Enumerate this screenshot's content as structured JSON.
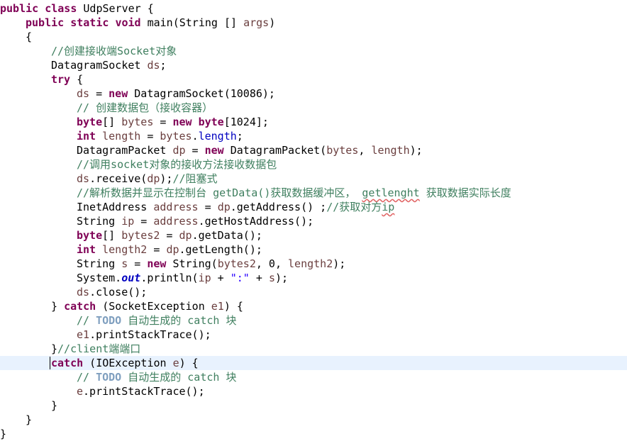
{
  "editor": {
    "lines": [
      {
        "indent": 0,
        "tokens": [
          {
            "t": "public",
            "c": "kw"
          },
          {
            "t": " "
          },
          {
            "t": "class",
            "c": "kw"
          },
          {
            "t": " UdpServer {"
          }
        ]
      },
      {
        "indent": 1,
        "tokens": [
          {
            "t": "public",
            "c": "kw"
          },
          {
            "t": " "
          },
          {
            "t": "static",
            "c": "kw"
          },
          {
            "t": " "
          },
          {
            "t": "void",
            "c": "kw"
          },
          {
            "t": " main(String [] "
          },
          {
            "t": "args",
            "c": "var"
          },
          {
            "t": ")"
          }
        ]
      },
      {
        "indent": 1,
        "tokens": [
          {
            "t": "{"
          }
        ]
      },
      {
        "indent": 2,
        "tokens": [
          {
            "t": "//创建接收端Socket对象",
            "c": "cm"
          }
        ]
      },
      {
        "indent": 2,
        "tokens": [
          {
            "t": "DatagramSocket "
          },
          {
            "t": "ds",
            "c": "var"
          },
          {
            "t": ";"
          }
        ]
      },
      {
        "indent": 2,
        "tokens": [
          {
            "t": "try",
            "c": "kw"
          },
          {
            "t": " {"
          }
        ]
      },
      {
        "indent": 3,
        "tokens": [
          {
            "t": "ds",
            "c": "var"
          },
          {
            "t": " = "
          },
          {
            "t": "new",
            "c": "kw"
          },
          {
            "t": " DatagramSocket(10086);"
          }
        ]
      },
      {
        "indent": 3,
        "tokens": [
          {
            "t": "// 创建数据包（接收容器）",
            "c": "cm"
          }
        ]
      },
      {
        "indent": 3,
        "tokens": [
          {
            "t": "byte",
            "c": "kw"
          },
          {
            "t": "[] "
          },
          {
            "t": "bytes",
            "c": "var"
          },
          {
            "t": " = "
          },
          {
            "t": "new",
            "c": "kw"
          },
          {
            "t": " "
          },
          {
            "t": "byte",
            "c": "kw"
          },
          {
            "t": "[1024];"
          }
        ]
      },
      {
        "indent": 3,
        "tokens": [
          {
            "t": "int",
            "c": "kw"
          },
          {
            "t": " "
          },
          {
            "t": "length",
            "c": "var"
          },
          {
            "t": " = "
          },
          {
            "t": "bytes",
            "c": "var"
          },
          {
            "t": "."
          },
          {
            "t": "length",
            "c": "fld"
          },
          {
            "t": ";"
          }
        ]
      },
      {
        "indent": 3,
        "tokens": [
          {
            "t": "DatagramPacket "
          },
          {
            "t": "dp",
            "c": "var"
          },
          {
            "t": " = "
          },
          {
            "t": "new",
            "c": "kw"
          },
          {
            "t": " DatagramPacket("
          },
          {
            "t": "bytes",
            "c": "var"
          },
          {
            "t": ", "
          },
          {
            "t": "length",
            "c": "var"
          },
          {
            "t": ");"
          }
        ]
      },
      {
        "indent": 3,
        "tokens": [
          {
            "t": "//调用socket对象的接收方法接收数据包",
            "c": "cm"
          }
        ]
      },
      {
        "indent": 3,
        "tokens": [
          {
            "t": "ds",
            "c": "var"
          },
          {
            "t": ".receive("
          },
          {
            "t": "dp",
            "c": "var"
          },
          {
            "t": ");"
          },
          {
            "t": "//阻塞式",
            "c": "cm"
          }
        ]
      },
      {
        "indent": 3,
        "tokens": [
          {
            "t": "//解析数据并显示在控制台 getData()获取数据缓冲区， ",
            "c": "cm"
          },
          {
            "t": "getlenght",
            "c": "cm sq"
          },
          {
            "t": " 获取数据实际长度",
            "c": "cm"
          }
        ]
      },
      {
        "indent": 3,
        "tokens": [
          {
            "t": "InetAddress "
          },
          {
            "t": "address",
            "c": "var"
          },
          {
            "t": " = "
          },
          {
            "t": "dp",
            "c": "var"
          },
          {
            "t": ".getAddress() ;"
          },
          {
            "t": "//获取对方",
            "c": "cm"
          },
          {
            "t": "ip",
            "c": "cm sq"
          }
        ]
      },
      {
        "indent": 3,
        "tokens": [
          {
            "t": "String "
          },
          {
            "t": "ip",
            "c": "var"
          },
          {
            "t": " = "
          },
          {
            "t": "address",
            "c": "var"
          },
          {
            "t": ".getHostAddress();"
          }
        ]
      },
      {
        "indent": 3,
        "tokens": [
          {
            "t": "byte",
            "c": "kw"
          },
          {
            "t": "[] "
          },
          {
            "t": "bytes2",
            "c": "var"
          },
          {
            "t": " = "
          },
          {
            "t": "dp",
            "c": "var"
          },
          {
            "t": ".getData();"
          }
        ]
      },
      {
        "indent": 3,
        "tokens": [
          {
            "t": "int",
            "c": "kw"
          },
          {
            "t": " "
          },
          {
            "t": "length2",
            "c": "var"
          },
          {
            "t": " = "
          },
          {
            "t": "dp",
            "c": "var"
          },
          {
            "t": ".getLength();"
          }
        ]
      },
      {
        "indent": 3,
        "tokens": [
          {
            "t": "String "
          },
          {
            "t": "s",
            "c": "var"
          },
          {
            "t": " = "
          },
          {
            "t": "new",
            "c": "kw"
          },
          {
            "t": " String("
          },
          {
            "t": "bytes2",
            "c": "var"
          },
          {
            "t": ", 0, "
          },
          {
            "t": "length2",
            "c": "var"
          },
          {
            "t": ");"
          }
        ]
      },
      {
        "indent": 3,
        "tokens": [
          {
            "t": "System."
          },
          {
            "t": "out",
            "c": "sfld"
          },
          {
            "t": ".println("
          },
          {
            "t": "ip",
            "c": "var"
          },
          {
            "t": " + "
          },
          {
            "t": "\":\"",
            "c": "str"
          },
          {
            "t": " + "
          },
          {
            "t": "s",
            "c": "var"
          },
          {
            "t": ");"
          }
        ]
      },
      {
        "indent": 3,
        "tokens": [
          {
            "t": "ds",
            "c": "var"
          },
          {
            "t": ".close();"
          }
        ]
      },
      {
        "indent": 2,
        "tokens": [
          {
            "t": "} "
          },
          {
            "t": "catch",
            "c": "kw"
          },
          {
            "t": " (SocketException "
          },
          {
            "t": "e1",
            "c": "var"
          },
          {
            "t": ") {"
          }
        ]
      },
      {
        "indent": 3,
        "tokens": [
          {
            "t": "// ",
            "c": "cm"
          },
          {
            "t": "TODO",
            "c": "td"
          },
          {
            "t": " 自动生成的 catch 块",
            "c": "cm"
          }
        ]
      },
      {
        "indent": 3,
        "tokens": [
          {
            "t": "e1",
            "c": "var"
          },
          {
            "t": ".printStackTrace();"
          }
        ]
      },
      {
        "indent": 2,
        "tokens": [
          {
            "t": "}"
          },
          {
            "t": "//client端端口",
            "c": "cm"
          }
        ]
      },
      {
        "indent": 2,
        "tokens": [
          {
            "t": "catch",
            "c": "kw"
          },
          {
            "t": " (IOException "
          },
          {
            "t": "e",
            "c": "var"
          },
          {
            "t": ") {"
          }
        ],
        "current": true
      },
      {
        "indent": 3,
        "tokens": [
          {
            "t": "// ",
            "c": "cm"
          },
          {
            "t": "TODO",
            "c": "td"
          },
          {
            "t": " 自动生成的 catch 块",
            "c": "cm"
          }
        ]
      },
      {
        "indent": 3,
        "tokens": [
          {
            "t": "e",
            "c": "var"
          },
          {
            "t": ".printStackTrace();"
          }
        ]
      },
      {
        "indent": 2,
        "tokens": [
          {
            "t": "}"
          }
        ]
      },
      {
        "indent": 1,
        "tokens": [
          {
            "t": "}"
          }
        ]
      },
      {
        "indent": 0,
        "tokens": [
          {
            "t": "}"
          }
        ]
      }
    ]
  }
}
